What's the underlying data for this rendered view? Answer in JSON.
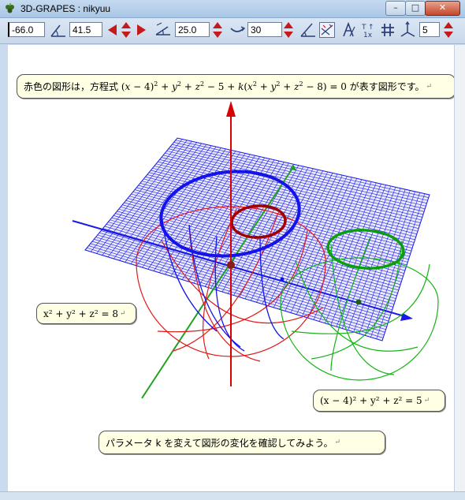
{
  "window": {
    "title": "3D-GRAPES : nikyuu",
    "minimize_label": "–",
    "maximize_label": "□",
    "close_label": "✕"
  },
  "toolbar": {
    "field1": "-66.0",
    "field2": "41.5",
    "field3": "25.0",
    "field4": "30",
    "field5": "5"
  },
  "notes": {
    "top_prefix": "赤色の図形は，方程式",
    "top_suffix": "が表す図形です。",
    "sphere_a": "x² + y² + z² = 8",
    "sphere_b": "(x − 4)² + y² + z² = 5",
    "bottom": "パラメータ k を変えて図形の変化を確認してみよう。"
  },
  "colors": {
    "plane": "#1a1ae6",
    "sphere_red": "#e11919",
    "sphere_green": "#14b414",
    "axis_x": "#1a1ae6",
    "axis_y": "#1fa31f",
    "axis_z": "#d90000",
    "circle_blue": "#1414e8",
    "circle_red": "#a00000",
    "circle_green": "#0d9e0d",
    "note_bg": "#ffffe4"
  }
}
